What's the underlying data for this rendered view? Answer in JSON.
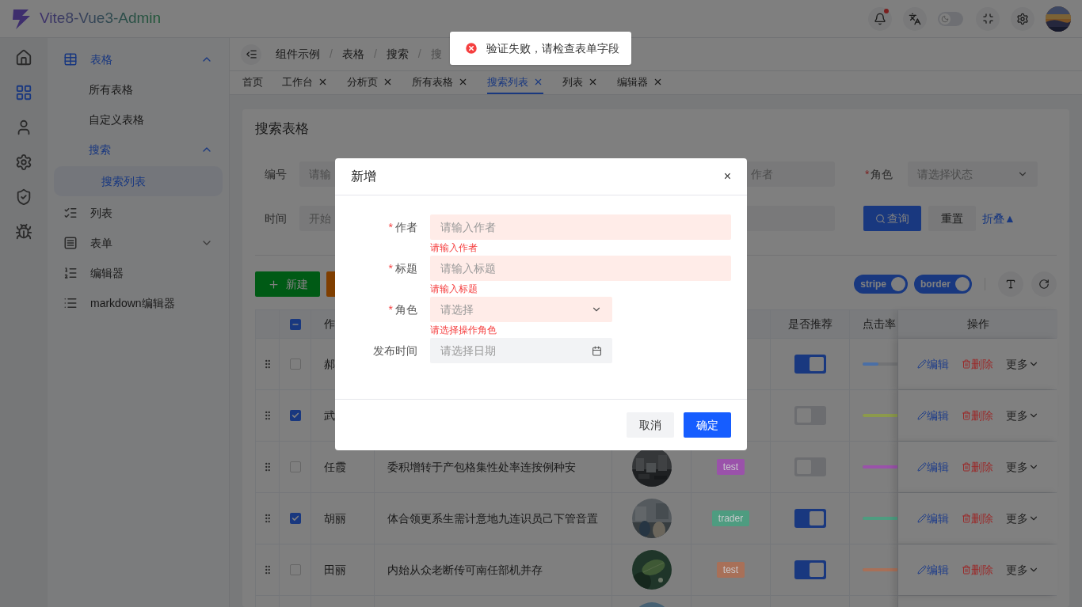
{
  "header": {
    "title": "Vite8-Vue3-Admin",
    "notification_dot": true,
    "dark_mode": false
  },
  "icon_rail": [
    {
      "selected": false
    },
    {
      "selected": true
    },
    {
      "selected": false
    },
    {
      "selected": false
    },
    {
      "selected": false
    },
    {
      "selected": false
    }
  ],
  "sidebar": {
    "menu": [
      {
        "label": "表格",
        "expanded": true,
        "children": [
          {
            "label": "所有表格",
            "selected": false
          },
          {
            "label": "自定义表格",
            "selected": false
          },
          {
            "label": "搜索",
            "expanded": true,
            "children": [
              {
                "label": "搜索列表",
                "selected": true
              }
            ]
          }
        ]
      },
      {
        "label": "列表",
        "selected": false
      },
      {
        "label": "表单",
        "expanded": false
      },
      {
        "label": "编辑器",
        "selected": false
      },
      {
        "label": "markdown编辑器",
        "selected": false
      }
    ]
  },
  "breadcrumb": {
    "separator": "/",
    "items": [
      "组件示例",
      "表格",
      "搜索",
      "搜"
    ]
  },
  "tabs": [
    {
      "label": "首页",
      "closable": false,
      "selected": false
    },
    {
      "label": "工作台",
      "closable": true,
      "selected": false
    },
    {
      "label": "分析页",
      "closable": true,
      "selected": false
    },
    {
      "label": "所有表格",
      "closable": true,
      "selected": false
    },
    {
      "label": "搜索列表",
      "closable": true,
      "selected": true
    },
    {
      "label": "列表",
      "closable": true,
      "selected": false
    },
    {
      "label": "编辑器",
      "closable": true,
      "selected": false
    }
  ],
  "card": {
    "title": "搜索表格",
    "search_form": {
      "id_label": "编号",
      "id_placeholder": "请输",
      "author_placeholder": "作者",
      "role_label": "角色",
      "role_required": true,
      "required_mark": "*",
      "role_placeholder": "请选择状态",
      "time_label": "时间",
      "time_placeholder": "开始",
      "query_button": "查询",
      "reset_button": "重置",
      "collapse_link": "折叠▲"
    },
    "toolbar": {
      "new_button": "新建",
      "stripe": {
        "label": "stripe",
        "on": true
      },
      "border": {
        "label": "border",
        "on": true
      }
    },
    "table": {
      "header": {
        "indeterminate": true,
        "author": "作",
        "recommend": "是否推荐",
        "click_rate": "点击率",
        "actions": "操作"
      },
      "rows": [
        {
          "checked": false,
          "author": "郝",
          "recommended": true,
          "level": 0.2,
          "color": "#4a6fa6",
          "actions": [
            "编辑",
            "删除",
            "更多"
          ]
        },
        {
          "checked": true,
          "author": "武",
          "recommended": false,
          "level": 0.6,
          "color": "#8c9a4c",
          "actions": [
            "编辑",
            "删除",
            "更多"
          ]
        },
        {
          "checked": false,
          "author": "任霞",
          "title": "委积增转于产包格集性处率连按例种安",
          "image": {
            "kind": "picture"
          },
          "tag": {
            "label": "test",
            "color": "#9a52aa"
          },
          "recommended": false,
          "level": 0.7,
          "color": "#9a52aa",
          "actions": [
            "编辑",
            "删除",
            "更多"
          ]
        },
        {
          "checked": true,
          "author": "胡丽",
          "title": "体合领更系生需计意地九连识员己下管音置",
          "image": {
            "kind": "picture"
          },
          "tag": {
            "label": "trader",
            "color": "#4e9c80"
          },
          "recommended": true,
          "level": 0.65,
          "color": "#4e9c80",
          "actions": [
            "编辑",
            "删除",
            "更多"
          ]
        },
        {
          "checked": false,
          "author": "田丽",
          "title": "内始从众老断传可南任部机并存",
          "image": {
            "kind": "picture"
          },
          "tag": {
            "label": "test",
            "color": "#a87058"
          },
          "recommended": true,
          "level": 0.75,
          "color": "#a87058",
          "actions": [
            "编辑",
            "删除",
            "更多"
          ]
        },
        {
          "image": {
            "kind": "picture"
          }
        }
      ]
    }
  },
  "toast": {
    "kind": "error",
    "message": "验证失败，请检查表单字段"
  },
  "dialog": {
    "title": "新增",
    "close": "×",
    "required_mark": "*",
    "fields": [
      {
        "kind": "input",
        "label": "作者",
        "required": true,
        "placeholder": "请输入作者",
        "error": "请输入作者"
      },
      {
        "kind": "input",
        "label": "标题",
        "required": true,
        "placeholder": "请输入标题",
        "error": "请输入标题"
      },
      {
        "kind": "select",
        "label": "角色",
        "required": true,
        "placeholder": "请选择",
        "error": "请选择操作角色"
      },
      {
        "kind": "date",
        "label": "发布时间",
        "required": false,
        "placeholder": "请选择日期"
      }
    ],
    "buttons": [
      {
        "label": "取消",
        "primary": false
      },
      {
        "label": "确定",
        "primary": true
      }
    ]
  }
}
